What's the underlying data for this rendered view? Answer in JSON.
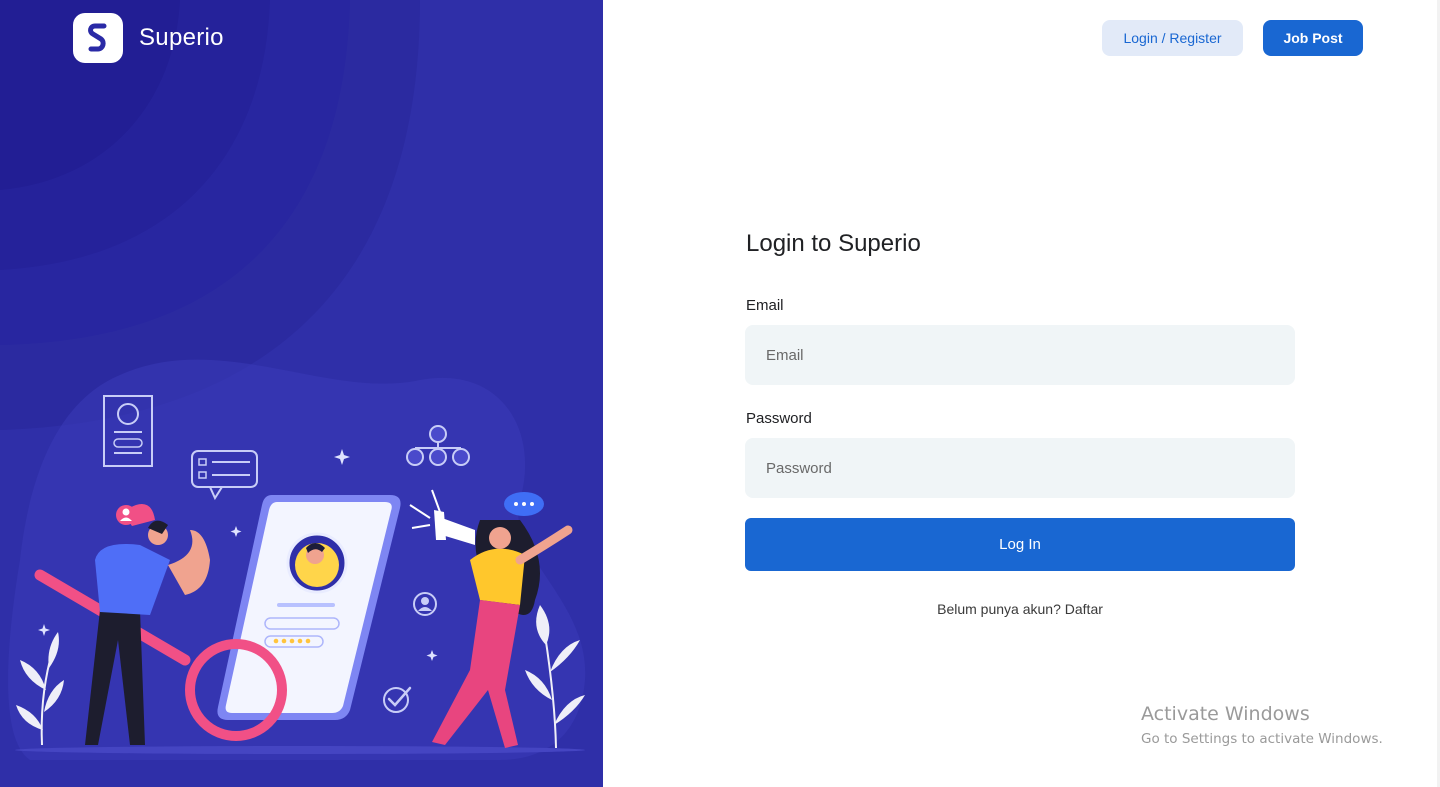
{
  "brand": {
    "name": "Superio",
    "logo_icon": "superio-s-logo-icon"
  },
  "header": {
    "login_register_label": "Login / Register",
    "job_post_label": "Job Post"
  },
  "form": {
    "title": "Login to Superio",
    "email": {
      "label": "Email",
      "placeholder": "Email",
      "value": ""
    },
    "password": {
      "label": "Password",
      "placeholder": "Password",
      "value": ""
    },
    "submit_label": "Log In",
    "signup_prompt": "Belum punya akun?",
    "signup_link": "Daftar"
  },
  "watermark": {
    "title": "Activate Windows",
    "subtitle": "Go to Settings to activate Windows."
  },
  "colors": {
    "left_panel_bg": "#2f2fa8",
    "primary": "#1967d2",
    "secondary_button_bg": "#e2eaf8",
    "input_bg": "#f0f5f7"
  }
}
